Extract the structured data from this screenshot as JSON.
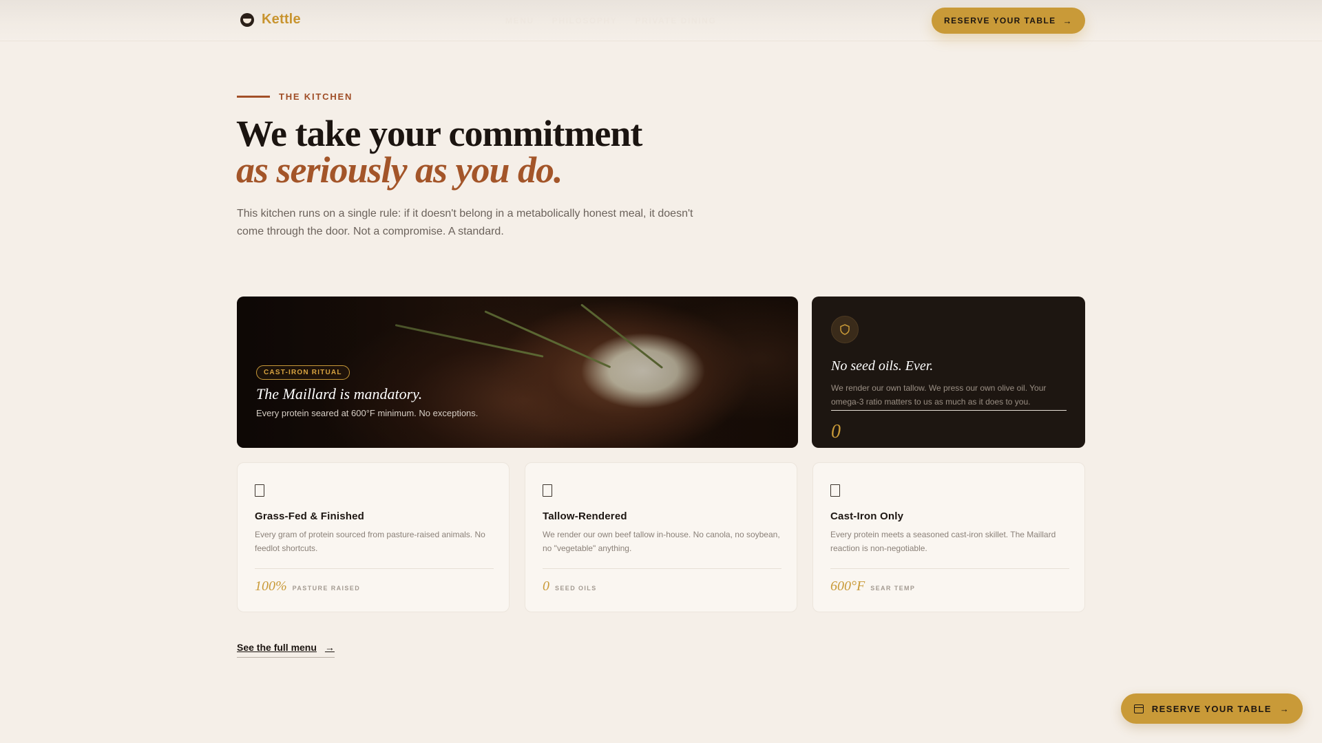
{
  "brand": {
    "name": "Kettle",
    "logo_icon": "kettle-logo-icon",
    "accent_color": "#c99a38"
  },
  "nav": {
    "items": [
      "MENU",
      "PHILOSOPHY",
      "PRIVATE DINING"
    ]
  },
  "header": {
    "cta_label": "RESERVE YOUR TABLE",
    "cta_icon": "arrow-right-icon"
  },
  "hero": {
    "eyebrow": "THE KITCHEN",
    "headline_line1": "We take your commitment",
    "headline_line2": "as seriously as you do.",
    "lede": "This kitchen runs on a single rule: if it doesn't belong in a metabolically honest meal, it doesn't come through the door. Not a compromise. A standard."
  },
  "feature_image_card": {
    "tag": "CAST-IRON RITUAL",
    "title": "The Maillard is mandatory.",
    "subtitle": "Every protein seared at 600°F minimum. No exceptions."
  },
  "seed_oil_card": {
    "icon": "shield-icon",
    "title": "No seed oils. Ever.",
    "body": "We render our own tallow. We press our own olive oil. Your omega-3 ratio matters to us as much as it does to you.",
    "stat": "0"
  },
  "feature_cards": [
    {
      "icon": "document-icon",
      "title": "Grass-Fed & Finished",
      "body": "Every gram of protein sourced from pasture-raised animals. No feedlot shortcuts.",
      "stat_value": "100%",
      "stat_label": "PASTURE RAISED"
    },
    {
      "icon": "document-icon",
      "title": "Tallow-Rendered",
      "body": "We render our own beef tallow in-house. No canola, no soybean, no \"vegetable\" anything.",
      "stat_value": "0",
      "stat_label": "SEED OILS"
    },
    {
      "icon": "document-icon",
      "title": "Cast-Iron Only",
      "body": "Every protein meets a seasoned cast-iron skillet. The Maillard reaction is non-negotiable.",
      "stat_value": "600°F",
      "stat_label": "SEAR TEMP"
    }
  ],
  "menu_link": {
    "label": "See the full menu",
    "icon": "arrow-right-icon"
  },
  "floating_cta": {
    "label": "RESERVE YOUR TABLE",
    "icon": "calendar-icon"
  }
}
